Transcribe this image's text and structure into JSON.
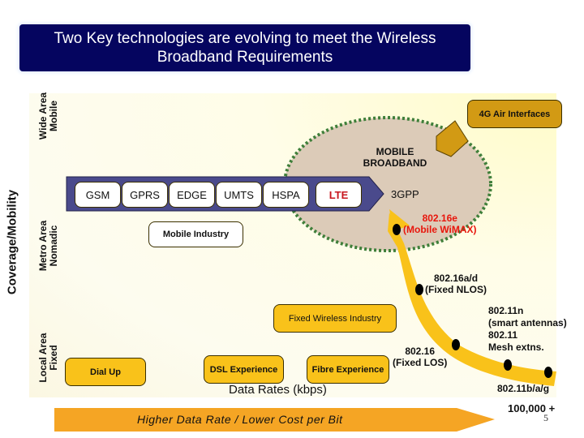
{
  "title": {
    "line1": "Two Key technologies are evolving to meet the Wireless",
    "line2": "Broadband Requirements"
  },
  "axes": {
    "y_label": "Coverage/Mobility",
    "y_levels": [
      {
        "line1": "Wide Area",
        "line2": "Mobile"
      },
      {
        "line1": "Metro Area",
        "line2": "Nomadic"
      },
      {
        "line1": "Local Area",
        "line2": "Fixed"
      }
    ],
    "x_label": "Data Rates (kbps)",
    "x_max_label": "100,000 +"
  },
  "mobile_path": {
    "technologies": [
      "GSM",
      "GPRS",
      "EDGE",
      "UMTS",
      "HSPA",
      "LTE"
    ],
    "highlight": "LTE",
    "end_label": "3GPP",
    "industry_label": "Mobile Industry"
  },
  "mobile_broadband": {
    "line1": "MOBILE",
    "line2": "BROADBAND"
  },
  "air_interfaces_label": "4G Air Interfaces",
  "fixed_path": {
    "industry_label": "Fixed Wireless Industry",
    "experiences": [
      "Dial Up",
      "DSL Experience",
      "Fibre Experience"
    ],
    "standards": [
      {
        "line1": "802.16e",
        "line2": "(Mobile WiMAX)",
        "color": "#e8160c"
      },
      {
        "line1": "802.16a/d",
        "line2": "(Fixed NLOS)",
        "color": "#111111"
      },
      {
        "line1": "802.16",
        "line2": "(Fixed LOS)",
        "color": "#111111"
      },
      {
        "line1": "802.11n",
        "line2": "(smart antennas)",
        "line3": "802.11",
        "line4": "Mesh extns.",
        "color": "#111111"
      },
      {
        "line1": "802.11b/a/g",
        "color": "#111111"
      }
    ]
  },
  "bottom_arrow": "Higher Data Rate / Lower Cost per Bit",
  "page_number": "5",
  "colors": {
    "title_bg": "#05055f",
    "gold": "#f9c21a",
    "mobile_band": "#4a4a8c",
    "ellipse_fill": "#dccbb8",
    "ellipse_dots": "#3f7f3a",
    "arrow_orange": "#f5a524",
    "red": "#e8160c"
  }
}
